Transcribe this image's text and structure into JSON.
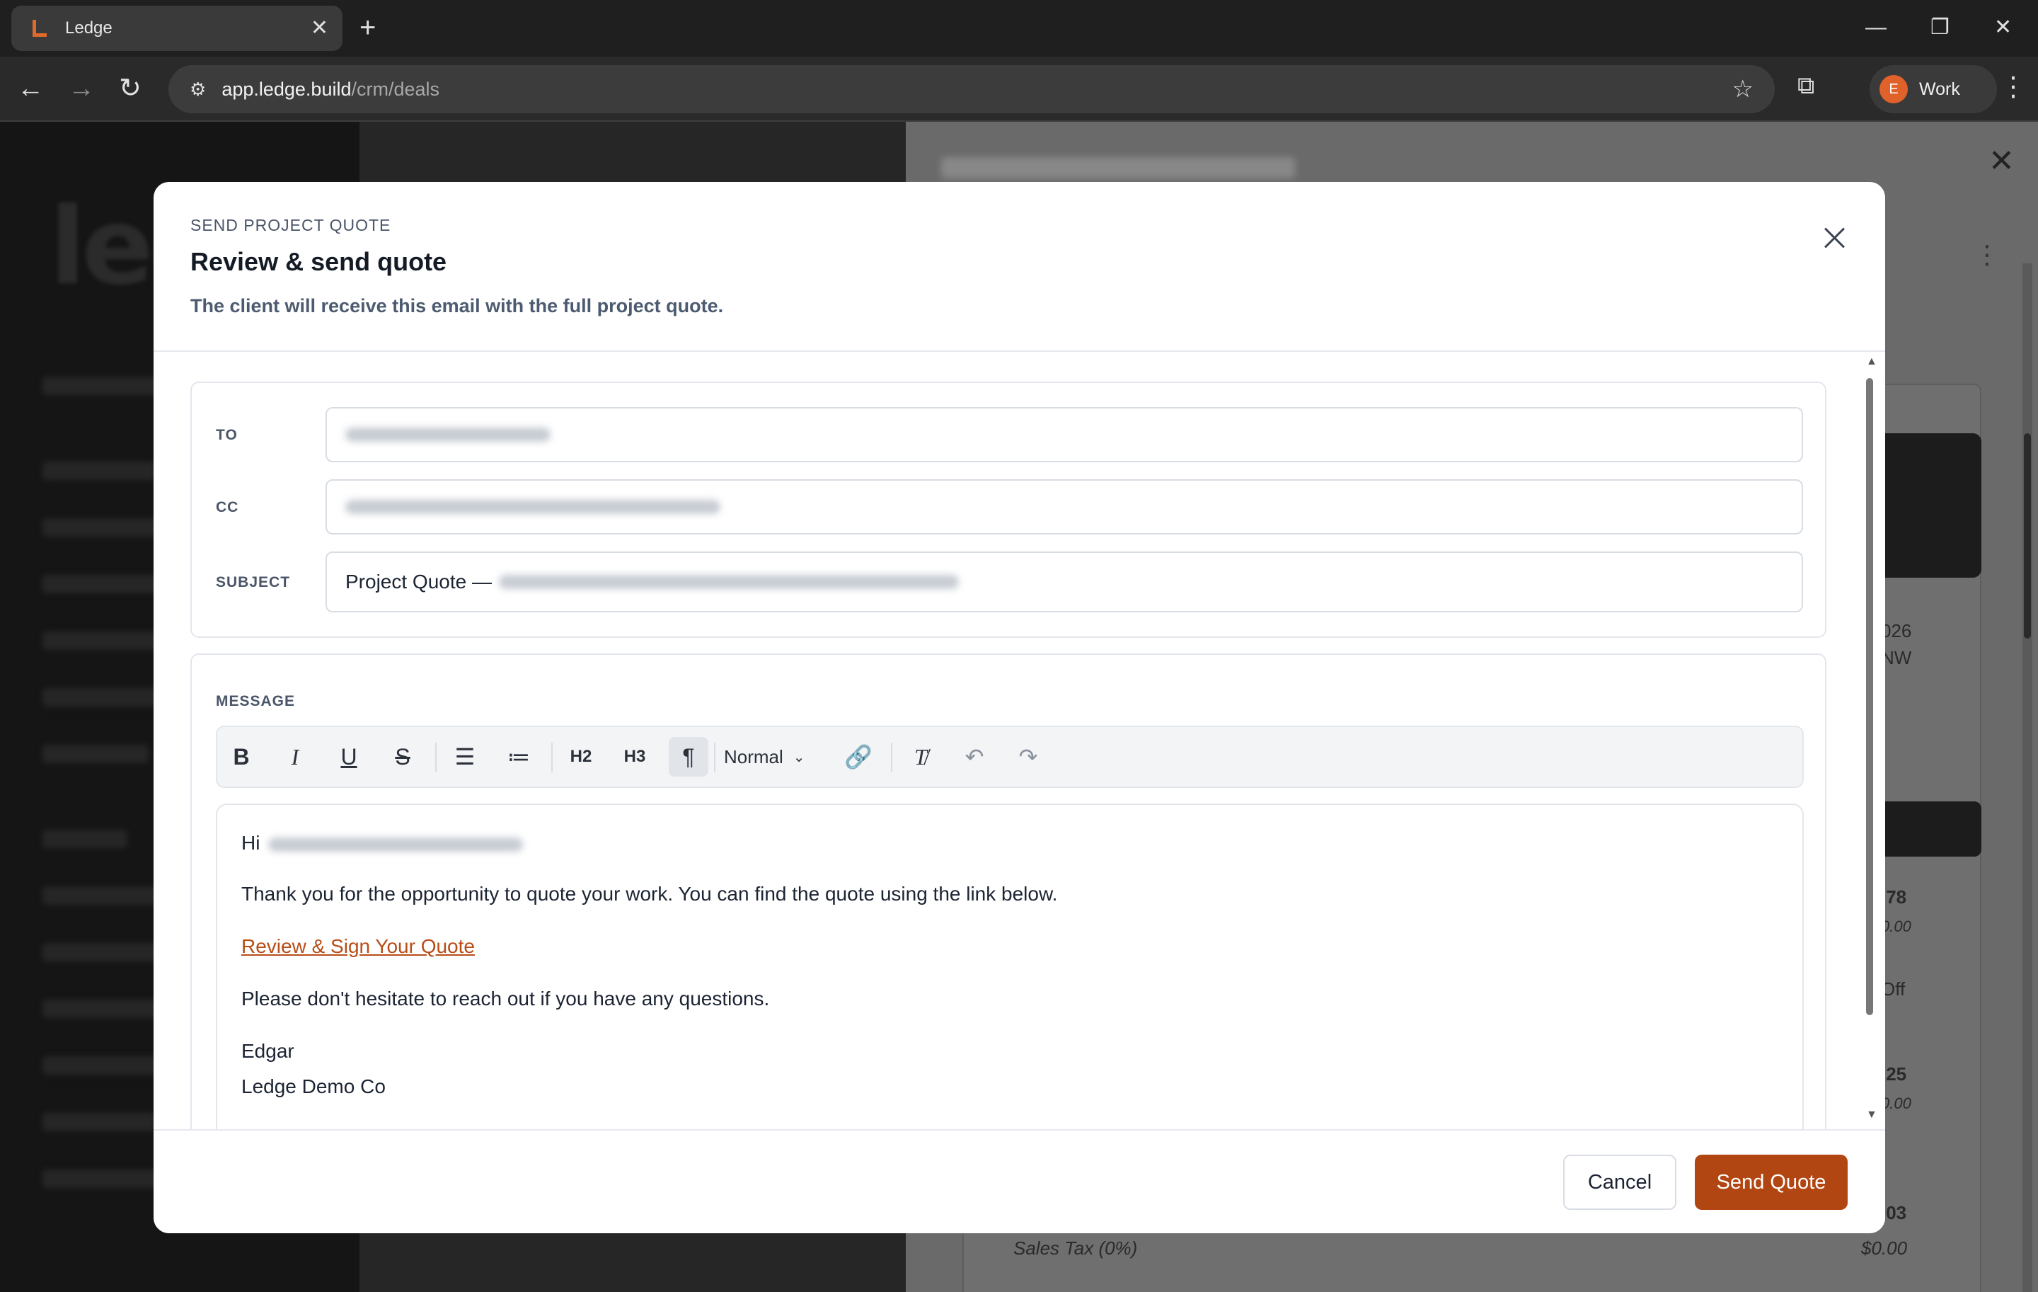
{
  "browser": {
    "tab_title": "Ledge",
    "url_host": "app.ledge.build",
    "url_path": "/crm/deals",
    "profile_initial": "E",
    "profile_label": "Work"
  },
  "background": {
    "drawer_values": [
      "026",
      "NW",
      ".78",
      "0.00",
      "Off",
      ".25",
      "0.00",
      ".03"
    ],
    "sales_tax_label": "Sales Tax (0%)",
    "sales_tax_value": "$0.00"
  },
  "modal": {
    "eyebrow": "SEND PROJECT QUOTE",
    "title": "Review & send quote",
    "subtitle": "The client will receive this email with the full project quote.",
    "to_label": "TO",
    "cc_label": "CC",
    "subject_label": "SUBJECT",
    "subject_prefix": "Project Quote —",
    "message_label": "MESSAGE",
    "format_select": "Normal",
    "body": {
      "greeting": "Hi",
      "line1": "Thank you for the opportunity to quote your work. You can find the quote using the link below.",
      "link": "Review & Sign Your Quote",
      "line2": "Please don't hesitate to reach out if you have any questions.",
      "sig_name": "Edgar",
      "sig_company": "Ledge Demo Co"
    },
    "cancel_label": "Cancel",
    "send_label": "Send Quote"
  },
  "toolbar_icons": {
    "bold": "B",
    "italic": "I",
    "underline": "U",
    "strike": "S",
    "h2": "H2",
    "h3": "H3"
  }
}
